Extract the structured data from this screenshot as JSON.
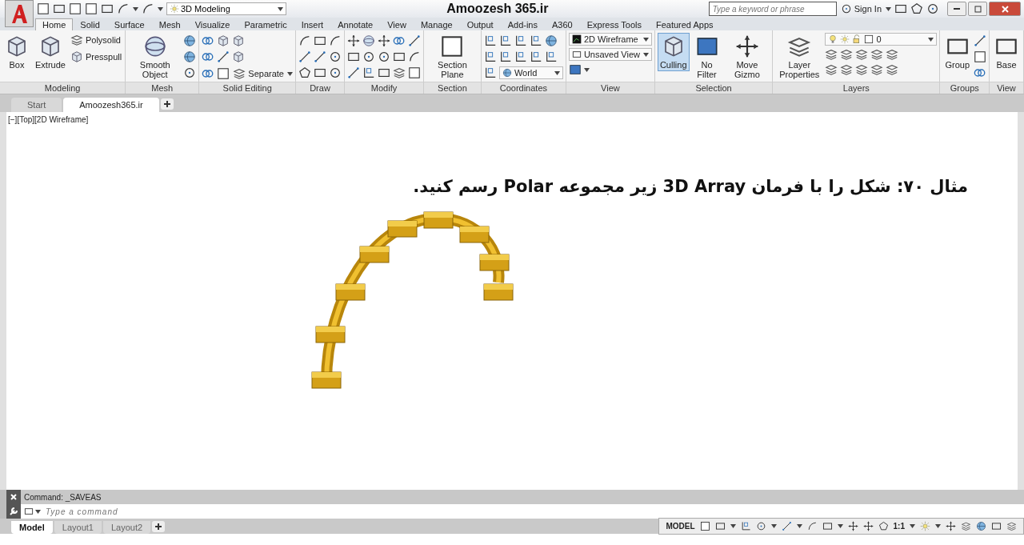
{
  "window": {
    "title": "Amoozesh 365.ir",
    "workspace": "3D Modeling",
    "search": {
      "placeholder": "Type a keyword or phrase"
    },
    "sign_in": "Sign In"
  },
  "ribbon_tabs": [
    {
      "label": "Home",
      "selected": true
    },
    {
      "label": "Solid",
      "selected": false
    },
    {
      "label": "Surface",
      "selected": false
    },
    {
      "label": "Mesh",
      "selected": false
    },
    {
      "label": "Visualize",
      "selected": false
    },
    {
      "label": "Parametric",
      "selected": false
    },
    {
      "label": "Insert",
      "selected": false
    },
    {
      "label": "Annotate",
      "selected": false
    },
    {
      "label": "View",
      "selected": false
    },
    {
      "label": "Manage",
      "selected": false
    },
    {
      "label": "Output",
      "selected": false
    },
    {
      "label": "Add-ins",
      "selected": false
    },
    {
      "label": "A360",
      "selected": false
    },
    {
      "label": "Express Tools",
      "selected": false
    },
    {
      "label": "Featured Apps",
      "selected": false
    }
  ],
  "panels": [
    {
      "kind": "modeling",
      "title": "Modeling",
      "big_buttons": [
        {
          "label": "Box",
          "selected": false
        },
        {
          "label": "Extrude",
          "selected": false
        }
      ],
      "small_buttons": [
        "Polysolid",
        "Presspull"
      ]
    },
    {
      "kind": "mesh",
      "title": "Mesh",
      "big_buttons": [
        {
          "label": "Smooth Object",
          "selected": false
        }
      ]
    },
    {
      "kind": "solid_editing",
      "title": "Solid Editing",
      "small_buttons": [
        "Separate"
      ]
    },
    {
      "kind": "draw",
      "title": "Draw"
    },
    {
      "kind": "modify",
      "title": "Modify"
    },
    {
      "kind": "section",
      "title": "Section",
      "big_buttons": [
        {
          "label": "Section Plane",
          "selected": false
        }
      ]
    },
    {
      "kind": "coordinates",
      "title": "Coordinates",
      "dropdowns": [
        "World"
      ]
    },
    {
      "kind": "view",
      "title": "View",
      "dropdowns": [
        "2D Wireframe",
        "Unsaved View"
      ]
    },
    {
      "kind": "selection",
      "title": "Selection",
      "big_buttons": [
        {
          "label": "Culling",
          "selected": true
        },
        {
          "label": "No Filter",
          "selected": false
        },
        {
          "label": "Move Gizmo",
          "selected": false
        }
      ]
    },
    {
      "kind": "layers",
      "title": "Layers",
      "big_buttons": [
        {
          "label": "Layer Properties",
          "selected": false
        }
      ],
      "dropdowns": [
        "0"
      ]
    },
    {
      "kind": "groups",
      "title": "Groups",
      "big_buttons": [
        {
          "label": "Group",
          "selected": false
        }
      ]
    },
    {
      "kind": "view2",
      "title": "View",
      "big_buttons": [
        {
          "label": "Base",
          "selected": false
        }
      ]
    }
  ],
  "file_tabs": [
    {
      "label": "Start",
      "selected": false
    },
    {
      "label": "Amoozesh365.ir",
      "selected": true
    }
  ],
  "viewport": {
    "label": "[−][Top][2D Wireframe]",
    "heading": "مثال ۷۰: شکل را با فرمان 3D Array زیر مجموعه Polar رسم کنید."
  },
  "command_line": {
    "history": "Command:  _SAVEAS",
    "placeholder": "Type a command"
  },
  "layout_tabs": [
    {
      "label": "Model",
      "selected": true
    },
    {
      "label": "Layout1",
      "selected": false
    },
    {
      "label": "Layout2",
      "selected": false
    }
  ],
  "status_bar": {
    "space": "MODEL",
    "scale": "1:1"
  }
}
